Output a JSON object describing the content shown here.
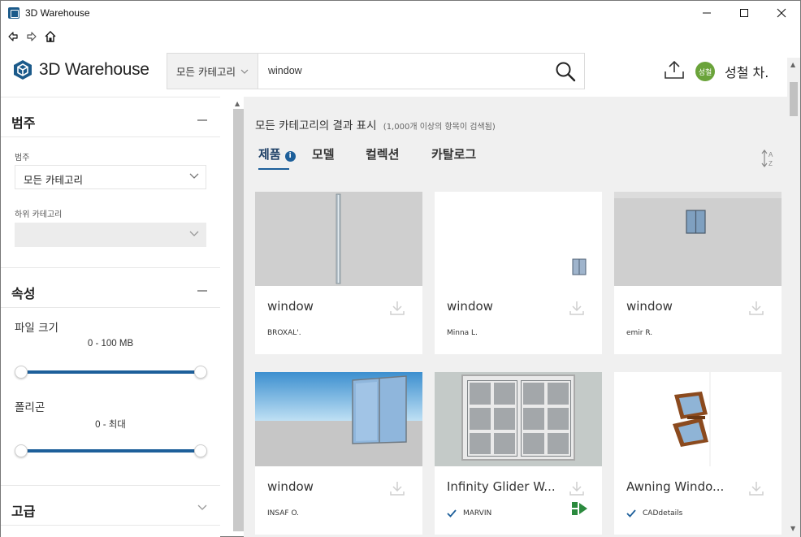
{
  "window": {
    "title": "3D Warehouse",
    "icon": "sketchup-icon"
  },
  "header": {
    "logo_text": "3D Warehouse",
    "search": {
      "category": "모든 카테고리",
      "query": "window"
    },
    "avatar_initials": "성철",
    "avatar_color": "#6aa33a",
    "username": "성철 차."
  },
  "sidebar": {
    "category_section": {
      "title": "범주",
      "category_label": "범주",
      "category_value": "모든 카테고리",
      "subcategory_label": "하위 카테고리",
      "subcategory_value": ""
    },
    "properties_section": {
      "title": "속성",
      "file_size_label": "파일 크기",
      "file_size_range": "0 - 100 MB",
      "polygons_label": "폴리곤",
      "polygons_range": "0 - 최대"
    },
    "advanced_section": {
      "title": "고급"
    }
  },
  "main": {
    "results_title": "모든 카테고리의 결과 표시",
    "results_count": "(1,000개 이상의 항목이 검색됨)",
    "tabs": [
      {
        "label": "제품",
        "active": true
      },
      {
        "label": "모델",
        "active": false
      },
      {
        "label": "컬렉션",
        "active": false
      },
      {
        "label": "카탈로그",
        "active": false
      }
    ],
    "cards": [
      {
        "name": "window",
        "author": "BROXAL'.",
        "verified": false
      },
      {
        "name": "window",
        "author": "Minna L.",
        "verified": false
      },
      {
        "name": "window",
        "author": "emir R.",
        "verified": false
      },
      {
        "name": "window",
        "author": "INSAF O.",
        "verified": false
      },
      {
        "name": "Infinity Glider W...",
        "author": "MARVIN",
        "verified": true
      },
      {
        "name": "Awning Windo...",
        "author": "CADdetails",
        "verified": true
      }
    ]
  },
  "colors": {
    "accent": "#1d5f9a",
    "main_bg": "#f0f0f0",
    "splitter": "#c9c9c9"
  }
}
